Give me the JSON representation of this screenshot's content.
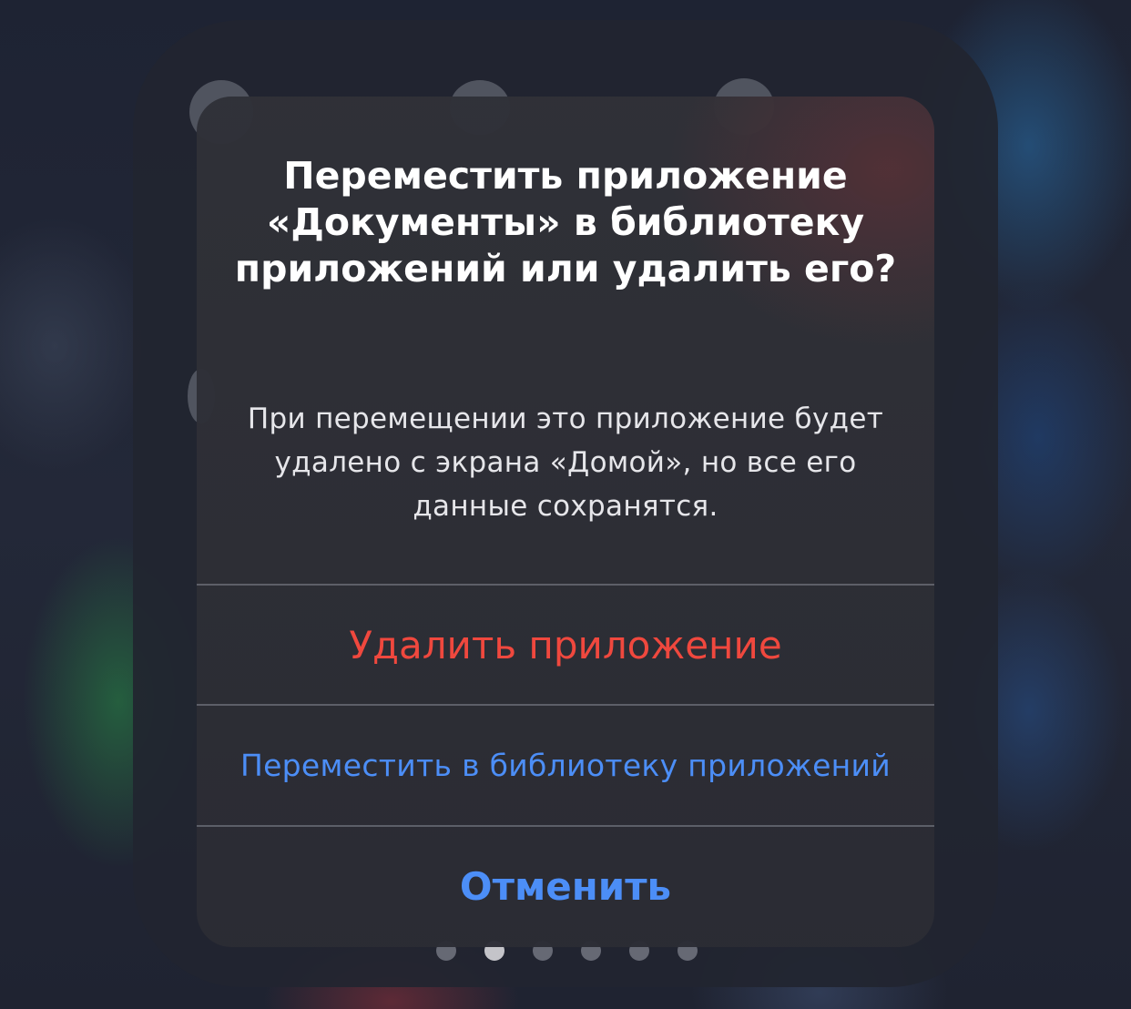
{
  "alert": {
    "title": "Переместить приложение «Документы» в библиотеку приложений или удалить его?",
    "message": "При перемещении это приложение будет удалено с экрана «Домой», но все его данные сохранятся.",
    "actions": {
      "delete_label": "Удалить приложение",
      "move_label": "Переместить в библиотеку приложений",
      "cancel_label": "Отменить"
    }
  },
  "page_indicator": {
    "count": 6,
    "active_index": 1
  },
  "colors": {
    "destructive": "#f0483e",
    "accent": "#4c8ef7",
    "title": "#ffffff"
  }
}
